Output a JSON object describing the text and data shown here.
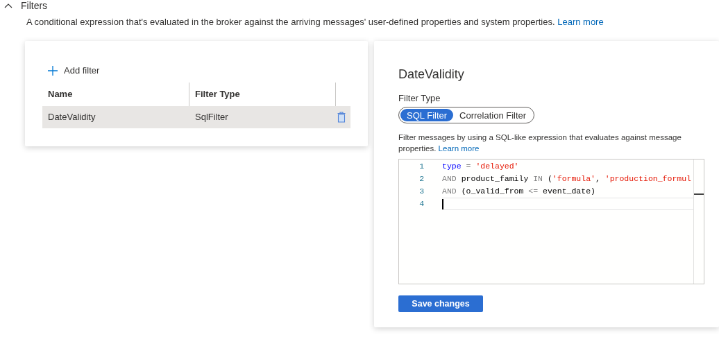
{
  "section": {
    "title": "Filters",
    "expanded": true
  },
  "description": {
    "text": "A conditional expression that's evaluated in the broker against the arriving messages' user-defined properties and system properties.",
    "link": "Learn more"
  },
  "filter_list": {
    "add_button": "Add filter",
    "columns": [
      "Name",
      "Filter Type"
    ],
    "rows": [
      {
        "name": "DateValidity",
        "type": "SqlFilter",
        "selected": true
      }
    ]
  },
  "detail": {
    "title": "DateValidity",
    "filter_type_label": "Filter Type",
    "filter_types": [
      {
        "label": "SQL Filter",
        "selected": true
      },
      {
        "label": "Correlation Filter",
        "selected": false
      }
    ],
    "help": "Filter messages by using a SQL-like expression that evaluates against message properties.",
    "help_link": "Learn more",
    "editor_lines": [
      {
        "number": "1",
        "tokens": [
          {
            "kind": "keyword",
            "text": "type"
          },
          {
            "kind": "operator",
            "text": " = "
          },
          {
            "kind": "string",
            "text": "'delayed'"
          }
        ]
      },
      {
        "number": "2",
        "tokens": [
          {
            "kind": "operator",
            "text": "AND"
          },
          {
            "kind": "plain",
            "text": " product_family "
          },
          {
            "kind": "operator",
            "text": "IN"
          },
          {
            "kind": "plain",
            "text": " ("
          },
          {
            "kind": "string",
            "text": "'formula'"
          },
          {
            "kind": "plain",
            "text": ", "
          },
          {
            "kind": "string",
            "text": "'production_formul"
          }
        ]
      },
      {
        "number": "3",
        "tokens": [
          {
            "kind": "operator",
            "text": "AND"
          },
          {
            "kind": "plain",
            "text": " (o_valid_from "
          },
          {
            "kind": "operator",
            "text": "<="
          },
          {
            "kind": "plain",
            "text": " event_date)"
          }
        ]
      },
      {
        "number": "4",
        "current": true
      }
    ],
    "save_button": "Save changes"
  }
}
